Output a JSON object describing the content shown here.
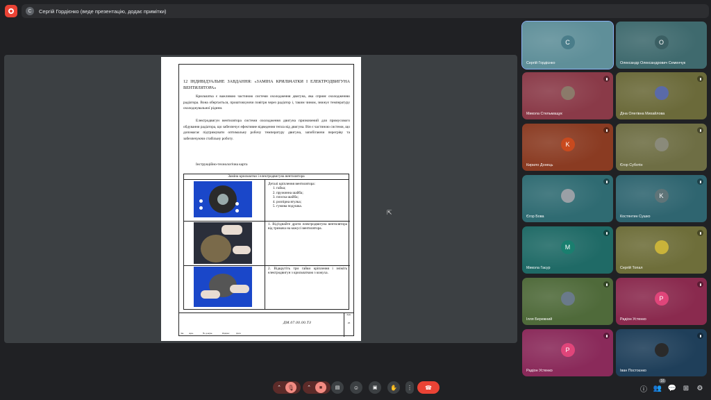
{
  "presenter_bar": {
    "avatar_letter": "С",
    "text": "Сергій Гордієнко (веде презентацію, додає примітки)"
  },
  "document": {
    "title": "12 ІНДИВІДУАЛЬНЕ ЗАВДАННЯ: «ЗАМІНА КРИЛЬЧАТКИ І ЕЛЕКТРОДВИГУНА ВЕНТИЛЯТОРА»",
    "paragraph_1": "Крильчатка є важливою частиною системи охолодження двигуна, яка сприяє охолодженню радіатора. Вона обертається, проштовхуючи повітря через радіатор і, таким чином, знижує температуру охолоджувальної рідини.",
    "paragraph_2": "Електродвигун вентилятора системи охолодження двигуна призначений для примусового обдування радіатора, що забезпечує ефективне відведення тепла від двигуна. Він є частиною системи, що допомагає підтримувати оптимальну робочу температуру двигуна, запобігаючи перегріву та забезпечуючи стабільну роботу.",
    "card_title": "Інструкційно-технологічна карта",
    "table_header": "Заміна крильчатки і електродвигуна вентилятора",
    "step1_heading": "Деталі кріплення вентилятора:",
    "step1_items": [
      "гайка;",
      "пружинна шайба;",
      "плоска шайба;",
      "розпірна втулка;",
      "гумова подушка."
    ],
    "step2_text": "1. Від'єднайте дроти електродвигуна вентилятора від тримача на кожусі вентилятора.",
    "step3_text": "2. Відкрутіть три гайки кріплення і зніміть електродвигун з крильчаткою з кожуха.",
    "stamp_code": "ДМ.07.00.00.ТЗ",
    "stamp_sheet_label": "Арк.",
    "stamp_sheet_number": "26",
    "stamp_cells": [
      "Зм.",
      "Арк.",
      "№ докум.",
      "Підпис",
      "Дата"
    ]
  },
  "participants": [
    {
      "name": "Сергій Гордієнко",
      "avatar": "С",
      "bg": "#5f8f99",
      "avatar_bg": "#4a7d8a",
      "muted": false,
      "active": true
    },
    {
      "name": "Олександр Олександрович Семенчук",
      "avatar": "О",
      "bg": "#3f6a6e",
      "avatar_bg": "#3b5f63",
      "muted": false,
      "active": false
    },
    {
      "name": "Микола Стельмащук",
      "avatar": "",
      "bg": "#8a3a48",
      "avatar_bg": "#8b7a6a",
      "muted": true,
      "active": false
    },
    {
      "name": "Діна Олегівна Михайлова",
      "avatar": "",
      "bg": "#6b6a3a",
      "avatar_bg": "#5a6aa8",
      "muted": true,
      "active": false
    },
    {
      "name": "Кирило Донець",
      "avatar": "K",
      "bg": "#8a3b22",
      "avatar_bg": "#c94a1e",
      "muted": true,
      "active": false
    },
    {
      "name": "Єгор Суботін",
      "avatar": "",
      "bg": "#6e6e44",
      "avatar_bg": "#8a8a7a",
      "muted": true,
      "active": false
    },
    {
      "name": "Єгор Бова",
      "avatar": "",
      "bg": "#2f6b72",
      "avatar_bg": "#9aa0a6",
      "muted": true,
      "active": false
    },
    {
      "name": "Костянтин Сушко",
      "avatar": "K",
      "bg": "#2f6570",
      "avatar_bg": "#5f7478",
      "muted": true,
      "active": false
    },
    {
      "name": "Микола Гаєур",
      "avatar": "M",
      "bg": "#1f6a66",
      "avatar_bg": "#1a7f6f",
      "muted": true,
      "active": false
    },
    {
      "name": "Сергій Топал",
      "avatar": "",
      "bg": "#6e6e3a",
      "avatar_bg": "#c9b33a",
      "muted": true,
      "active": false
    },
    {
      "name": "Ілля Бережний",
      "avatar": "",
      "bg": "#4f6a3a",
      "avatar_bg": "#6a7a8a",
      "muted": true,
      "active": false
    },
    {
      "name": "Радіон Устенко",
      "avatar": "P",
      "bg": "#8a2a4e",
      "avatar_bg": "#e0457a",
      "muted": true,
      "active": false
    },
    {
      "name": "Радіон Устенко",
      "avatar": "P",
      "bg": "#8a2a5a",
      "avatar_bg": "#e0457a",
      "muted": true,
      "active": false
    },
    {
      "name": "Іван Постоєнко",
      "avatar": "",
      "bg": "#1f3f5a",
      "avatar_bg": "#2a2a2a",
      "muted": true,
      "active": false
    }
  ],
  "controls": {
    "participant_count": "16",
    "colors": {
      "mute": "#f28b82",
      "muted_bg": "#5c2b29",
      "end_call": "#ea4335",
      "dark": "#3c4043"
    }
  }
}
